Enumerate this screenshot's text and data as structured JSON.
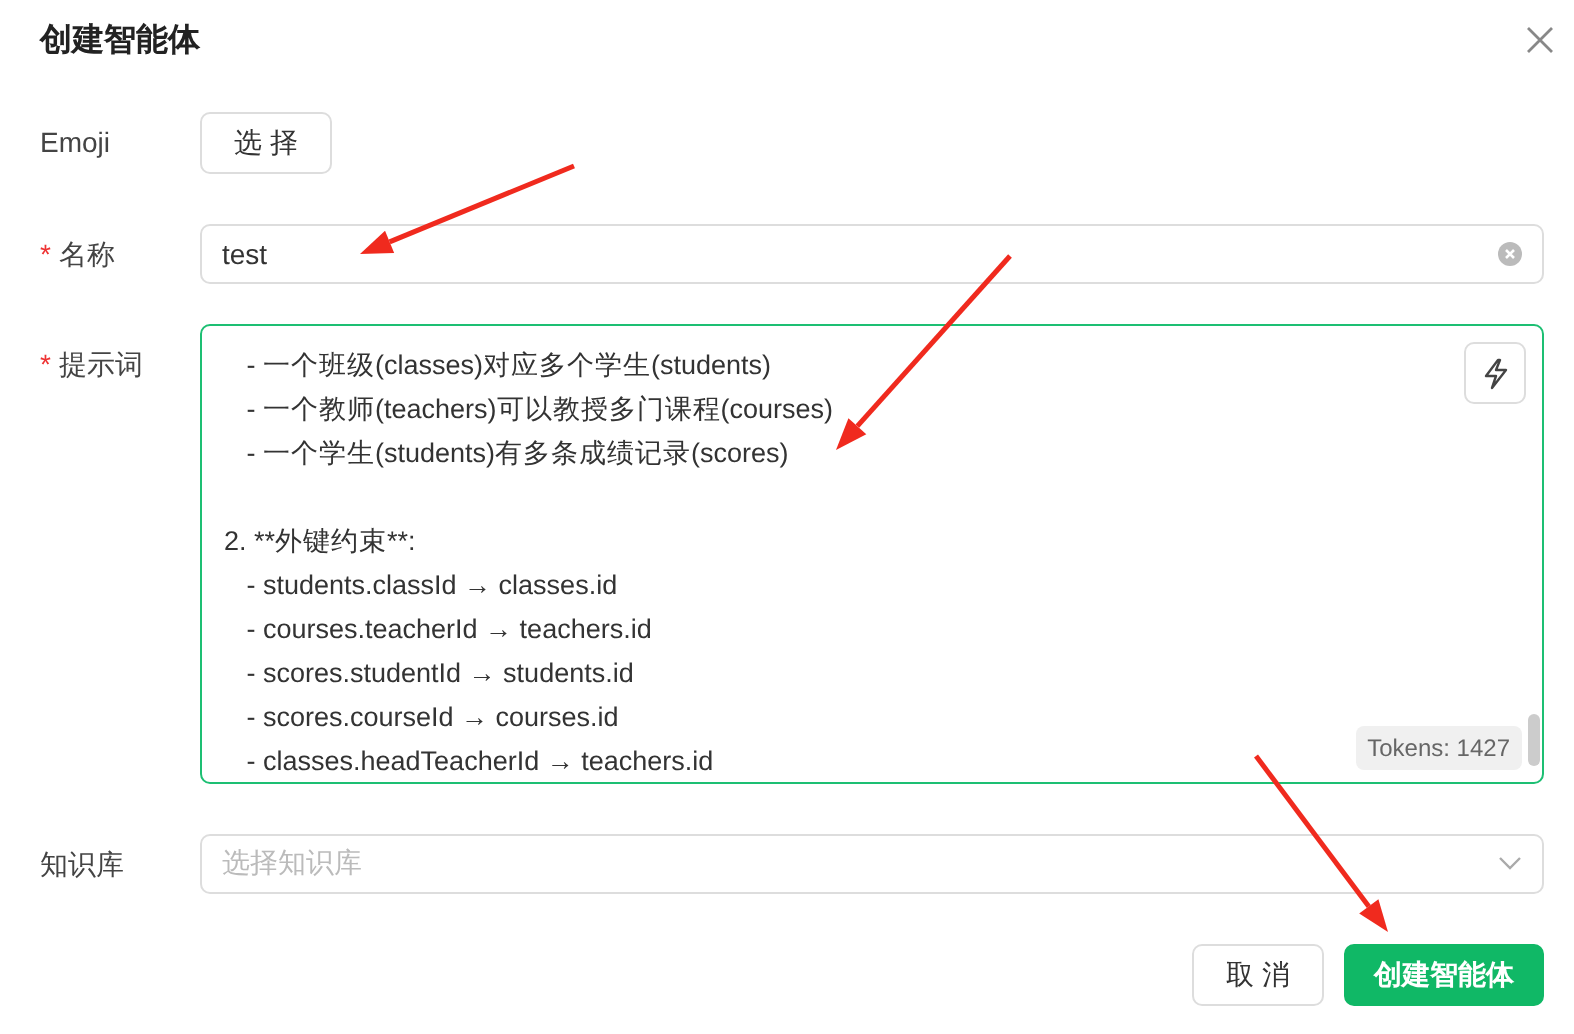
{
  "dialog": {
    "title": "创建智能体"
  },
  "fields": [
    {
      "kind": "emoji",
      "label": "Emoji",
      "button": "选 择"
    },
    {
      "kind": "text",
      "label": "名称",
      "mark": "*",
      "value": "test"
    },
    {
      "kind": "prompt",
      "label": "提示词",
      "mark": "*",
      "paragraphs": [
        [
          "   - 一个班级(classes)对应多个学生(students)",
          "   - 一个教师(teachers)可以教授多门课程(courses)",
          "   - 一个学生(students)有多条成绩记录(scores)"
        ],
        [
          "2. **外键约束**:",
          "   - students.classId → classes.id",
          "   - courses.teacherId → teachers.id",
          "   - scores.studentId → students.id",
          "   - scores.courseId → courses.id",
          "   - classes.headTeacherId → teachers.id"
        ]
      ],
      "tokens": "Tokens: 1427"
    },
    {
      "kind": "select",
      "label": "知识库",
      "placeholder": "选择知识库"
    }
  ],
  "buttons": [
    {
      "label": "取 消",
      "kind": "default"
    },
    {
      "label": "创建智能体",
      "kind": "primary"
    }
  ]
}
